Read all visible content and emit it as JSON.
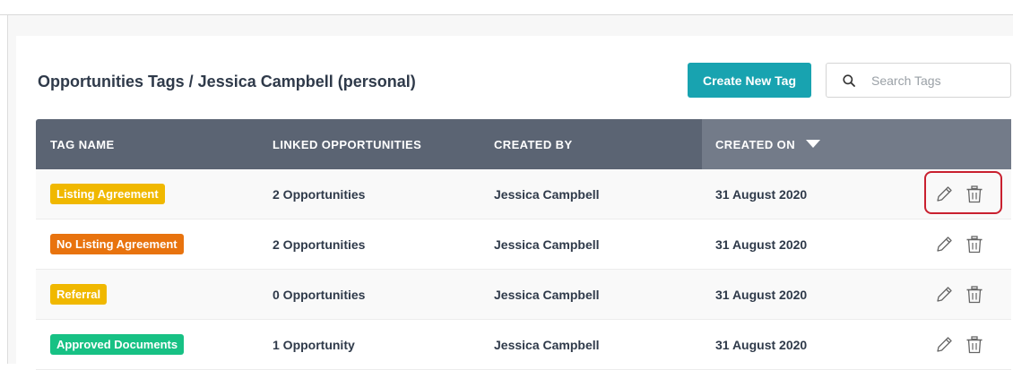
{
  "header": {
    "title": "Opportunities Tags / Jessica Campbell (personal)",
    "create_label": "Create New Tag",
    "search_placeholder": "Search Tags"
  },
  "table": {
    "columns": [
      "TAG NAME",
      "LINKED OPPORTUNITIES",
      "CREATED BY",
      "CREATED ON"
    ],
    "sorted_column": "CREATED ON",
    "sort_direction": "descending",
    "rows": [
      {
        "tag": "Listing Agreement",
        "tag_color": "#f0b800",
        "linked": "2 Opportunities",
        "created_by": "Jessica Campbell",
        "created_on": "31 August 2020"
      },
      {
        "tag": "No Listing Agreement",
        "tag_color": "#e8730e",
        "linked": "2 Opportunities",
        "created_by": "Jessica Campbell",
        "created_on": "31 August 2020"
      },
      {
        "tag": "Referral",
        "tag_color": "#f0b800",
        "linked": "0 Opportunities",
        "created_by": "Jessica Campbell",
        "created_on": "31 August 2020"
      },
      {
        "tag": "Approved Documents",
        "tag_color": "#17c184",
        "linked": "1 Opportunity",
        "created_by": "Jessica Campbell",
        "created_on": "31 August 2020"
      }
    ]
  },
  "colors": {
    "accent": "#18a3b0",
    "header_bg": "#5b6473",
    "highlight": "#c9202f"
  },
  "icons": [
    "search-icon",
    "sort-down-icon",
    "edit-pencil-icon",
    "trash-icon"
  ]
}
